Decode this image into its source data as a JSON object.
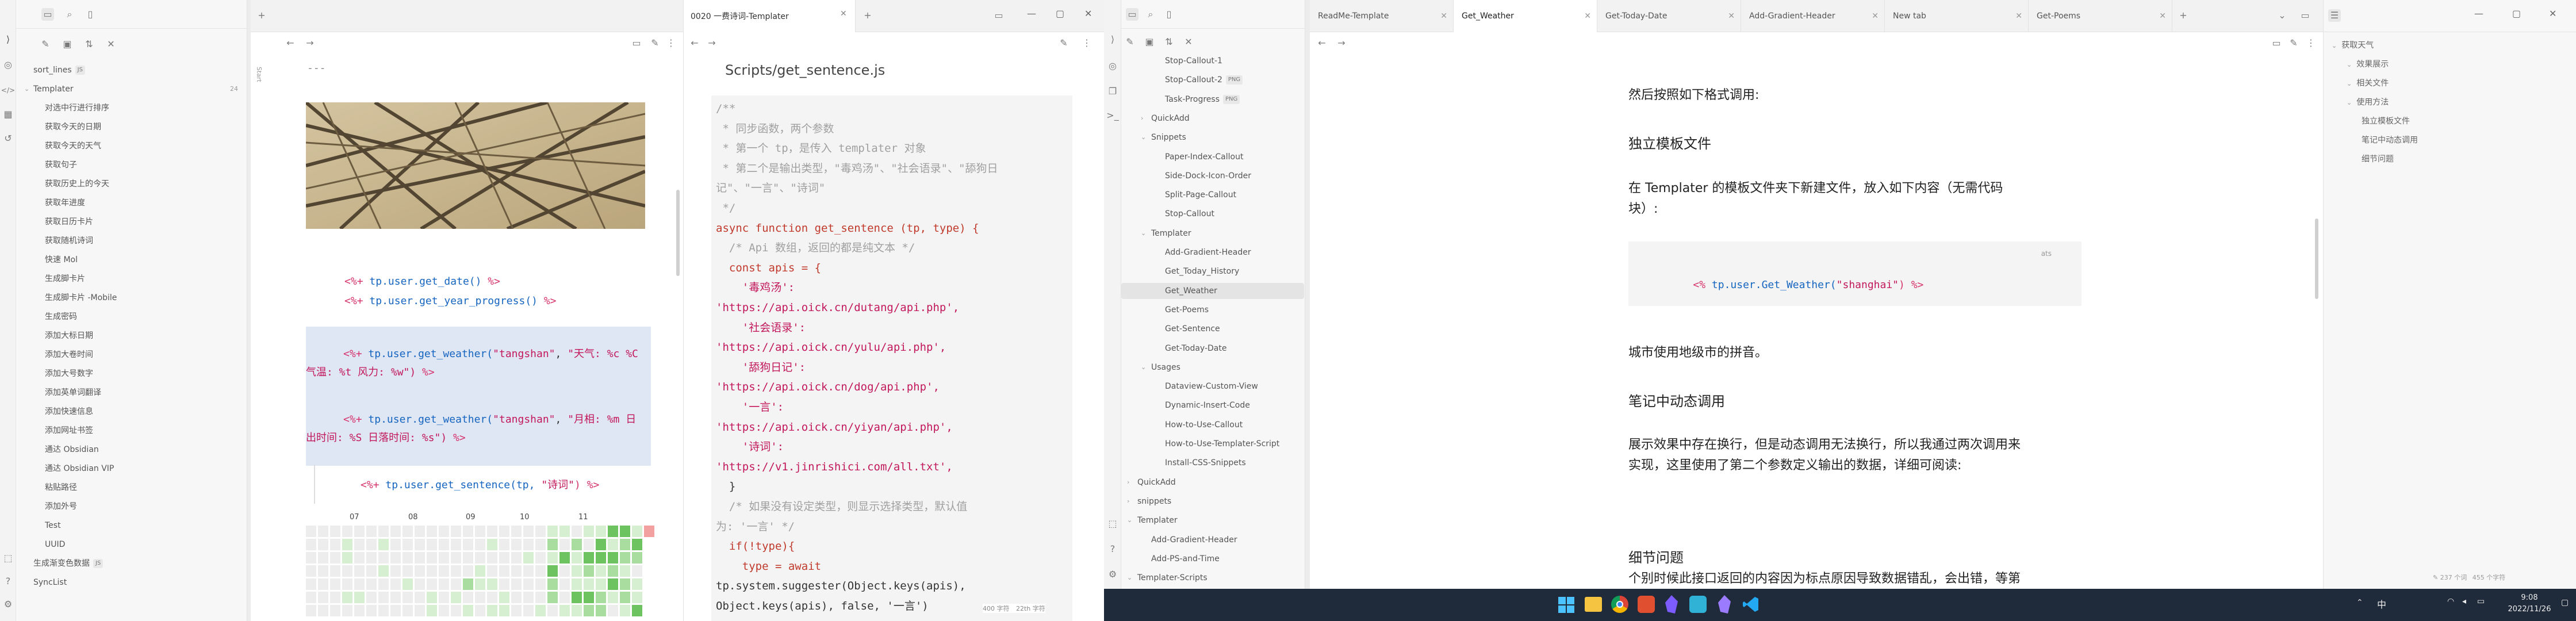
{
  "left_window": {
    "file_tree": {
      "items": [
        {
          "label": "sort_lines",
          "badge": "JS"
        },
        {
          "label": "Templater",
          "count": "24"
        },
        {
          "label": "对选中行进行排序"
        },
        {
          "label": "获取今天的日期"
        },
        {
          "label": "获取今天的天气"
        },
        {
          "label": "获取句子"
        },
        {
          "label": "获取历史上的今天"
        },
        {
          "label": "获取年进度"
        },
        {
          "label": "获取日历卡片"
        },
        {
          "label": "获取随机诗词"
        },
        {
          "label": "快速 Mol"
        },
        {
          "label": "生成脚卡片"
        },
        {
          "label": "生成脚卡片 -Mobile"
        },
        {
          "label": "生成密码"
        },
        {
          "label": "添加大标日期"
        },
        {
          "label": "添加大卷时间"
        },
        {
          "label": "添加大号数字"
        },
        {
          "label": "添加英单词翻译"
        },
        {
          "label": "添加快速信息"
        },
        {
          "label": "添加网址书签"
        },
        {
          "label": "通达 Obsidian"
        },
        {
          "label": "通达 Obsidian VIP"
        },
        {
          "label": "粘贴路径"
        },
        {
          "label": "添加外号"
        },
        {
          "label": "Test"
        },
        {
          "label": "UUID"
        },
        {
          "label": "生成渐变色数据",
          "badge": "JS"
        },
        {
          "label": "SyncList"
        }
      ]
    },
    "tab_title": "0020 一费诗词-Templater",
    "side_label": "Start",
    "editor_left": {
      "top_marker": "---",
      "lines": [
        {
          "open": "<%+ ",
          "code": "tp.user.get_date()",
          "close": " %>"
        },
        {
          "open": "<%+ ",
          "code": "tp.user.get_year_progress()",
          "close": " %>"
        },
        {
          "open": "<%+ ",
          "code": "tp.user.get_weather(",
          "arg1": "\"tangshan\"",
          "sep": ", ",
          "arg2": "\"天气: %c %C",
          "cont": "气温: %t 风力: %w\")",
          "close": " %>",
          "highlight": true
        },
        {
          "open": "<%+ ",
          "code": "tp.user.get_weather(",
          "arg1": "\"tangshan\"",
          "sep": ", ",
          "arg2": "\"月相: %m 日",
          "cont": "出时间: %S 日落时间: %s\")",
          "close": " %>",
          "highlight": true
        },
        {
          "open": "<%+ ",
          "code": "tp.user.get_sentence(tp, ",
          "arg1": "\"诗词\"",
          "close": ") %>"
        }
      ],
      "calendar_months": [
        "07",
        "08",
        "09",
        "10",
        "11"
      ]
    },
    "editor_right": {
      "path": "Scripts/get_sentence.js",
      "code": [
        {
          "t": "/**",
          "c": "cm"
        },
        {
          "t": " * 同步函数，两个参数",
          "c": "cm"
        },
        {
          "t": " * 第一个 tp，是传入 templater 对象",
          "c": "cm"
        },
        {
          "t": " * 第二个是输出类型，\"毒鸡汤\"、\"社会语录\"、\"舔狗日",
          "c": "cm"
        },
        {
          "t": "记\"、\"一言\"、\"诗词\"",
          "c": "cm"
        },
        {
          "t": " */",
          "c": "cm"
        },
        {
          "t": "async function get_sentence (tp, type) {",
          "c": "fnline"
        },
        {
          "t": "  /* Api 数组，返回的都是纯文本 */",
          "c": "cm"
        },
        {
          "t": "  const apis = {",
          "c": "kwline"
        },
        {
          "t": "    '毒鸡汤':",
          "c": "str"
        },
        {
          "t": "'https://api.oick.cn/dutang/api.php',",
          "c": "str"
        },
        {
          "t": "    '社会语录':",
          "c": "str"
        },
        {
          "t": "'https://api.oick.cn/yulu/api.php',",
          "c": "str"
        },
        {
          "t": "    '舔狗日记':",
          "c": "str"
        },
        {
          "t": "'https://api.oick.cn/dog/api.php',",
          "c": "str"
        },
        {
          "t": "    '一言':",
          "c": "str"
        },
        {
          "t": "'https://api.oick.cn/yiyan/api.php',",
          "c": "str"
        },
        {
          "t": "    '诗词':",
          "c": "str"
        },
        {
          "t": "'https://v1.jinrishici.com/all.txt',",
          "c": "str"
        },
        {
          "t": "  }",
          "c": "plain"
        },
        {
          "t": "  /* 如果没有设定类型，则显示选择类型，默认值",
          "c": "cm"
        },
        {
          "t": "为: '一言' */",
          "c": "cm"
        },
        {
          "t": "  if(!type){",
          "c": "kwline"
        },
        {
          "t": "    type = await",
          "c": "kwline"
        },
        {
          "t": "tp.system.suggester(Object.keys(apis),",
          "c": "plain"
        },
        {
          "t": "Object.keys(apis), false, '一言')",
          "c": "plain"
        }
      ],
      "status": [
        "400 字符",
        "22th 字符"
      ]
    }
  },
  "right_window": {
    "tabs": [
      {
        "label": "ReadMe-Template"
      },
      {
        "label": "Get_Weather",
        "active": true
      },
      {
        "label": "Get-Today-Date"
      },
      {
        "label": "Add-Gradient-Header"
      },
      {
        "label": "New tab"
      },
      {
        "label": "Get-Poems"
      }
    ],
    "tree": [
      {
        "label": "Stop-Callout-1",
        "indent": 2
      },
      {
        "label": "Stop-Callout-2",
        "indent": 2,
        "badge": "PNG"
      },
      {
        "label": "Task-Progress",
        "indent": 2,
        "badge": "PNG"
      },
      {
        "label": "QuickAdd",
        "indent": 1,
        "folder": true
      },
      {
        "label": "Snippets",
        "indent": 1,
        "folder": true,
        "open": true
      },
      {
        "label": "Paper-Index-Callout",
        "indent": 2
      },
      {
        "label": "Side-Dock-Icon-Order",
        "indent": 2
      },
      {
        "label": "Split-Page-Callout",
        "indent": 2
      },
      {
        "label": "Stop-Callout",
        "indent": 2
      },
      {
        "label": "Templater",
        "indent": 1,
        "folder": true,
        "open": true
      },
      {
        "label": "Add-Gradient-Header",
        "indent": 2
      },
      {
        "label": "Get_Today_History",
        "indent": 2
      },
      {
        "label": "Get_Weather",
        "indent": 2,
        "active": true
      },
      {
        "label": "Get-Poems",
        "indent": 2
      },
      {
        "label": "Get-Sentence",
        "indent": 2
      },
      {
        "label": "Get-Today-Date",
        "indent": 2
      },
      {
        "label": "Usages",
        "indent": 1,
        "folder": true,
        "open": true
      },
      {
        "label": "Dataview-Custom-View",
        "indent": 2
      },
      {
        "label": "Dynamic-Insert-Code",
        "indent": 2
      },
      {
        "label": "How-to-Use-Callout",
        "indent": 2
      },
      {
        "label": "How-to-Use-Templater-Script",
        "indent": 2
      },
      {
        "label": "Install-CSS-Snippets",
        "indent": 2
      },
      {
        "label": "QuickAdd",
        "indent": 0,
        "folder": true
      },
      {
        "label": "snippets",
        "indent": 0,
        "folder": true
      },
      {
        "label": "Templater",
        "indent": 0,
        "folder": true,
        "open": true
      },
      {
        "label": "Add-Gradient-Header",
        "indent": 1
      },
      {
        "label": "Add-PS-and-Time",
        "indent": 1
      },
      {
        "label": "Templater-Scripts",
        "indent": 0,
        "folder": true,
        "open": true
      }
    ],
    "doc": {
      "line0": "然后按照如下格式调用:",
      "h_standalone": "独立模板文件",
      "p_templater": "在 Templater 的模板文件夹下新建文件，放入如下内容（无需代码",
      "p_templater2": "块）:",
      "code_lang": "ats",
      "code_open": "<%",
      "code_mid": " tp.user.Get_Weather(",
      "code_arg": "\"shanghai\"",
      "code_close": ") %>",
      "p_city": "城市使用地级市的拼音。",
      "h_dynamic": "笔记中动态调用",
      "p_dynamic1": "展示效果中存在换行，但是动态调用无法换行，所以我通过两次调用来",
      "p_dynamic2": "实现，这里使用了第二个参数定义输出的数据，详细可阅读:",
      "h_detail": "细节问题",
      "p_detail": "个别时候此接口返回的内容因为标点原因导致数据错乱，会出错，等第"
    },
    "outline": [
      {
        "label": "获取天气",
        "level": 0
      },
      {
        "label": "效果展示",
        "level": 1
      },
      {
        "label": "相关文件",
        "level": 1
      },
      {
        "label": "使用方法",
        "level": 1
      },
      {
        "label": "独立模板文件",
        "level": 2
      },
      {
        "label": "笔记中动态调用",
        "level": 2
      },
      {
        "label": "细节问题",
        "level": 2
      }
    ],
    "status": [
      "237 个词",
      "455 个字符"
    ]
  },
  "taskbar": {
    "input_indicator": "中",
    "time": "9:08",
    "date": "2022/11/26"
  },
  "colors": {
    "accent": "#7c5cff",
    "taskbar": "#1f2a3a",
    "sidebar_bg": "#f5f5f5"
  }
}
